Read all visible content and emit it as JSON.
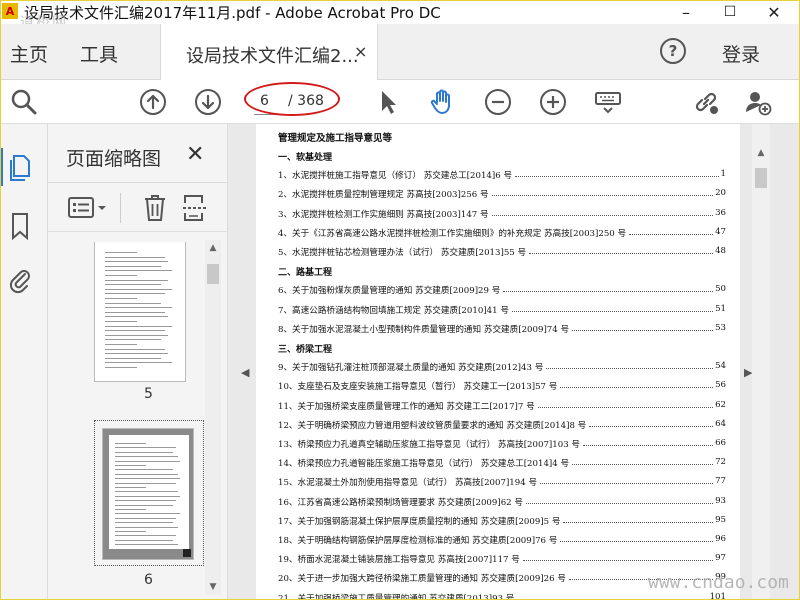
{
  "window": {
    "title": "设局技术文件汇编2017年11月.pdf - Adobe Acrobat Pro DC",
    "watermark_top": "道桥网",
    "minimize": "–",
    "maximize": "☐",
    "close": "✕"
  },
  "menu": {
    "home": "主页",
    "tools": "工具",
    "tab_label": "设局技术文件汇编2...",
    "tab_close": "×",
    "help": "?",
    "login": "登录"
  },
  "toolbar": {
    "current_page": "6",
    "total_pages": "/ 368"
  },
  "thumb_panel": {
    "title": "页面缩略图",
    "close": "✕",
    "thumbs": [
      {
        "label": "5"
      },
      {
        "label": "6"
      }
    ]
  },
  "document": {
    "heading": "管理规定及施工指导意见等",
    "lines": [
      {
        "type": "section",
        "text": "一、软基处理"
      },
      {
        "type": "entry",
        "text": "1、水泥搅拌桩施工指导意见（修订）  苏交建总工[2014]6 号",
        "page": "1"
      },
      {
        "type": "entry",
        "text": "2、水泥搅拌桩质量控制管理规定  苏高技[2003]256 号",
        "page": "20"
      },
      {
        "type": "entry",
        "text": "3、水泥搅拌桩检测工作实施细则  苏高技[2003]147 号",
        "page": "36"
      },
      {
        "type": "entry",
        "text": "4、关于《江苏省高速公路水泥搅拌桩检测工作实施细则》的补充规定  苏高技[2003]250 号",
        "page": "47"
      },
      {
        "type": "entry",
        "text": "5、水泥搅拌桩钻芯检测管理办法（试行）  苏交建质[2013]55 号",
        "page": "48"
      },
      {
        "type": "section",
        "text": "二、路基工程"
      },
      {
        "type": "entry",
        "text": "6、关于加强粉煤灰质量管理的通知  苏交建质[2009]29 号",
        "page": "50"
      },
      {
        "type": "entry",
        "text": "7、高速公路桥涵结构物回填施工规定  苏交建质[2010]41 号",
        "page": "51"
      },
      {
        "type": "entry",
        "text": "8、关于加强水泥混凝土小型预制构件质量管理的通知  苏交建质[2009]74 号",
        "page": "53"
      },
      {
        "type": "section",
        "text": "三、桥梁工程"
      },
      {
        "type": "entry",
        "text": "9、关于加强钻孔灌注桩顶部混凝土质量的通知  苏交建质[2012]43 号",
        "page": "54"
      },
      {
        "type": "entry",
        "text": "10、支座垫石及支座安装施工指导意见（暂行）  苏交建工一[2013]57 号",
        "page": "56"
      },
      {
        "type": "entry",
        "text": "11、关于加强桥梁支座质量管理工作的通知  苏交建工二[2017]7 号",
        "page": "62"
      },
      {
        "type": "entry",
        "text": "12、关于明确桥梁预应力管道用塑料波纹管质量要求的通知  苏交建质[2014]8 号",
        "page": "64"
      },
      {
        "type": "entry",
        "text": "13、桥梁预应力孔道真空辅助压浆施工指导意见（试行）  苏高技[2007]103 号",
        "page": "66"
      },
      {
        "type": "entry",
        "text": "14、桥梁预应力孔道智能压浆施工指导意见（试行）  苏交建总工[2014]4 号",
        "page": "72"
      },
      {
        "type": "entry",
        "text": "15、水泥混凝土外加剂使用指导意见（试行）  苏高技[2007]194 号",
        "page": "77"
      },
      {
        "type": "entry",
        "text": "16、江苏省高速公路桥梁预制场管理要求  苏交建质[2009]62 号",
        "page": "93"
      },
      {
        "type": "entry",
        "text": "17、关于加强钢筋混凝土保护层厚度质量控制的通知  苏交建质[2009]5 号",
        "page": "95"
      },
      {
        "type": "entry",
        "text": "18、关于明确结构钢筋保护层厚度检测标准的通知  苏交建质[2009]76 号",
        "page": "96"
      },
      {
        "type": "entry",
        "text": "19、桥面水泥混凝土铺装层施工指导意见  苏高技[2007]117 号",
        "page": "97"
      },
      {
        "type": "entry",
        "text": "20、关于进一步加强大跨径桥梁施工质量管理的通知  苏交建质[2009]26 号",
        "page": "99"
      },
      {
        "type": "entry",
        "text": "21、关于加强桥梁施工质量管理的通知  苏交建质[2013]93 号",
        "page": "101"
      }
    ]
  },
  "watermark_bottom": "www.cndao.com",
  "colors": {
    "accent": "#2a7ad2",
    "annotation": "#d21a1a"
  }
}
